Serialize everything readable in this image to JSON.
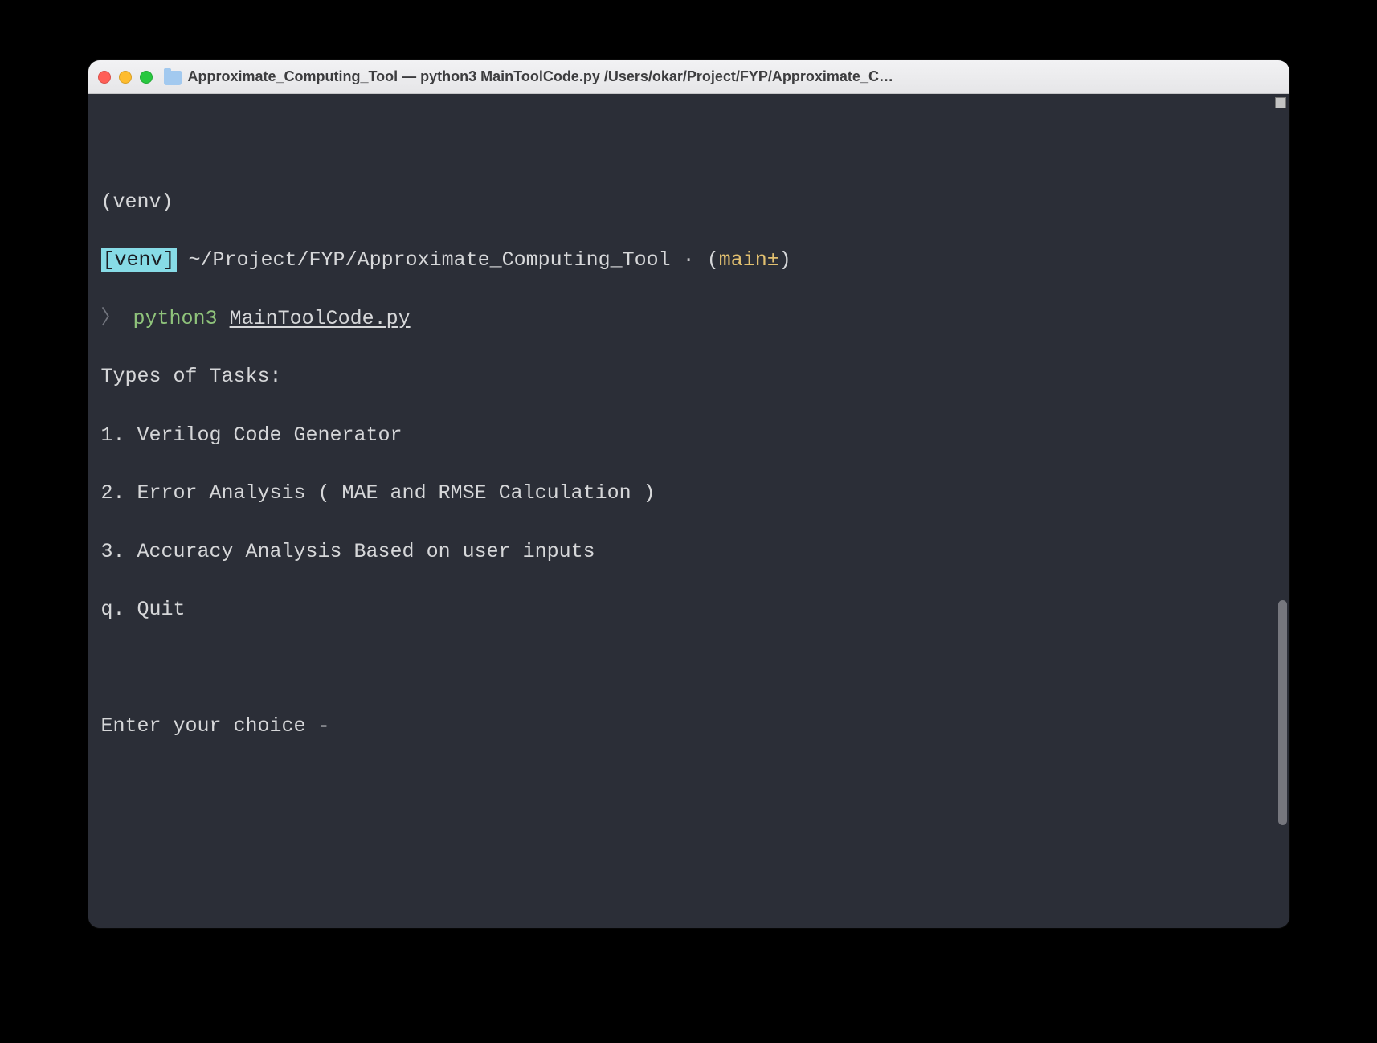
{
  "window": {
    "title": "Approximate_Computing_Tool — python3 MainToolCode.py  /Users/okar/Project/FYP/Approximate_C…"
  },
  "prompt": {
    "venv_top": "(venv)",
    "venv_tag": "[venv]",
    "cwd": "~/Project/FYP/Approximate_Computing_Tool",
    "separator": "·",
    "branch_open": "(",
    "branch": "main±",
    "branch_close": ")",
    "bracket_open": "〉",
    "command": "python3",
    "argument": "MainToolCode.py"
  },
  "output": {
    "header": "Types of Tasks:",
    "items": [
      "1. Verilog Code Generator",
      "2. Error Analysis ( MAE and RMSE Calculation )",
      "3. Accuracy Analysis Based on user inputs",
      "q. Quit"
    ],
    "prompt_input": "Enter your choice - "
  }
}
